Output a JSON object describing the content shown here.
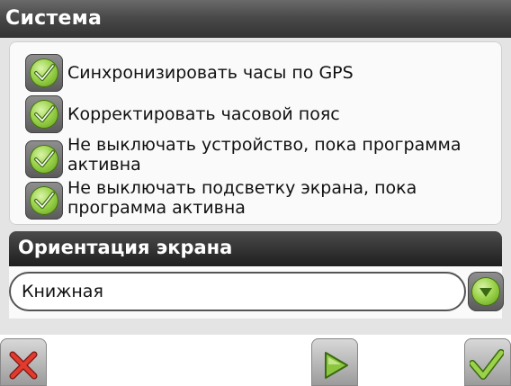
{
  "window": {
    "title": "Система"
  },
  "options": [
    {
      "label_lines": [
        "Синхронизировать часы по GPS"
      ],
      "checked": true
    },
    {
      "label_lines": [
        "Корректировать часовой пояс"
      ],
      "checked": true
    },
    {
      "label_lines": [
        "Не выключать устройство, пока программа",
        "активна"
      ],
      "checked": true
    },
    {
      "label_lines": [
        "Не выключать подсветку экрана, пока",
        "программа активна"
      ],
      "checked": true
    }
  ],
  "orientation": {
    "header": "Ориентация экрана",
    "selected": "Книжная"
  },
  "toolbar": {
    "cancel_icon": "close-x-icon",
    "next_icon": "play-arrow-icon",
    "confirm_icon": "checkmark-icon"
  },
  "colors": {
    "accent_green": "#8cc63f",
    "cancel_red": "#e23b2e",
    "header_dark": "#2a2a2a"
  }
}
